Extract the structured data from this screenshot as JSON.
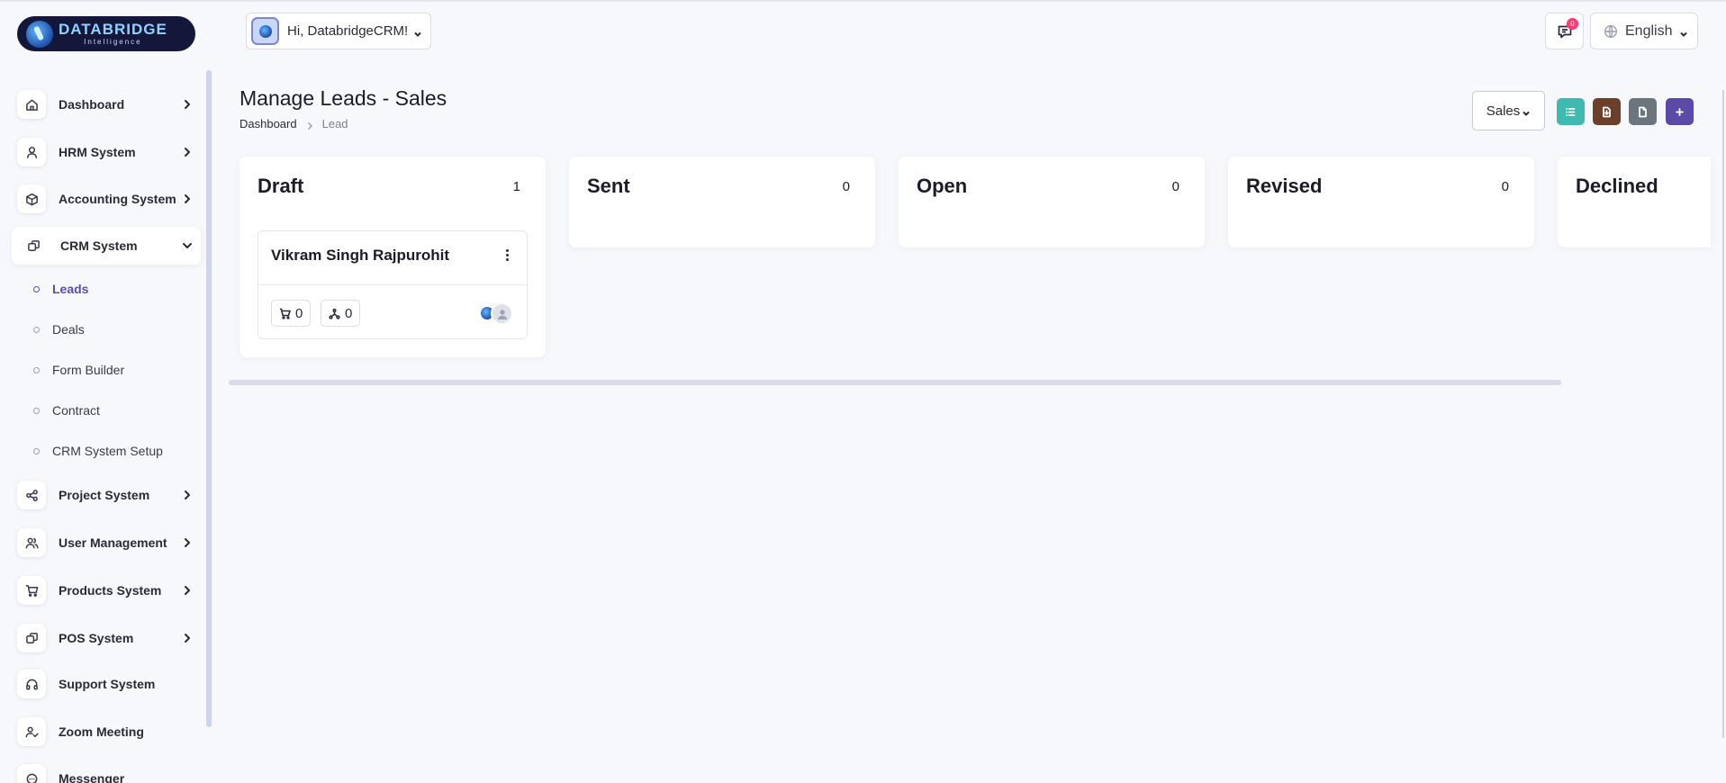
{
  "app": {
    "logo_name": "DATABRIDGE",
    "logo_sub": "Intelligence"
  },
  "header": {
    "greeting": "Hi, DatabridgeCRM!",
    "notifications_count": "0",
    "language": "English"
  },
  "sidebar": {
    "items": [
      {
        "label": "Dashboard"
      },
      {
        "label": "HRM System"
      },
      {
        "label": "Accounting System"
      },
      {
        "label": "CRM System"
      },
      {
        "label": "Project System"
      },
      {
        "label": "User Management"
      },
      {
        "label": "Products System"
      },
      {
        "label": "POS System"
      },
      {
        "label": "Support System"
      },
      {
        "label": "Zoom Meeting"
      },
      {
        "label": "Messenger"
      }
    ],
    "crm_sub": [
      {
        "label": "Leads",
        "current": true
      },
      {
        "label": "Deals"
      },
      {
        "label": "Form Builder"
      },
      {
        "label": "Contract"
      },
      {
        "label": "CRM System Setup"
      }
    ]
  },
  "page": {
    "title": "Manage Leads - Sales",
    "breadcrumb": [
      "Dashboard",
      "Lead"
    ],
    "pipeline_select": "Sales",
    "action_colors": {
      "list": "#3ebbb0",
      "import": "#6b3f2a",
      "export": "#6c757d",
      "add": "#5b4ba6"
    }
  },
  "board": {
    "columns": [
      {
        "title": "Draft",
        "count": "1"
      },
      {
        "title": "Sent",
        "count": "0"
      },
      {
        "title": "Open",
        "count": "0"
      },
      {
        "title": "Revised",
        "count": "0"
      },
      {
        "title": "Declined",
        "count": ""
      }
    ],
    "cards": [
      {
        "name": "Vikram Singh Rajpurohit",
        "products": "0",
        "sources": "0"
      }
    ]
  }
}
